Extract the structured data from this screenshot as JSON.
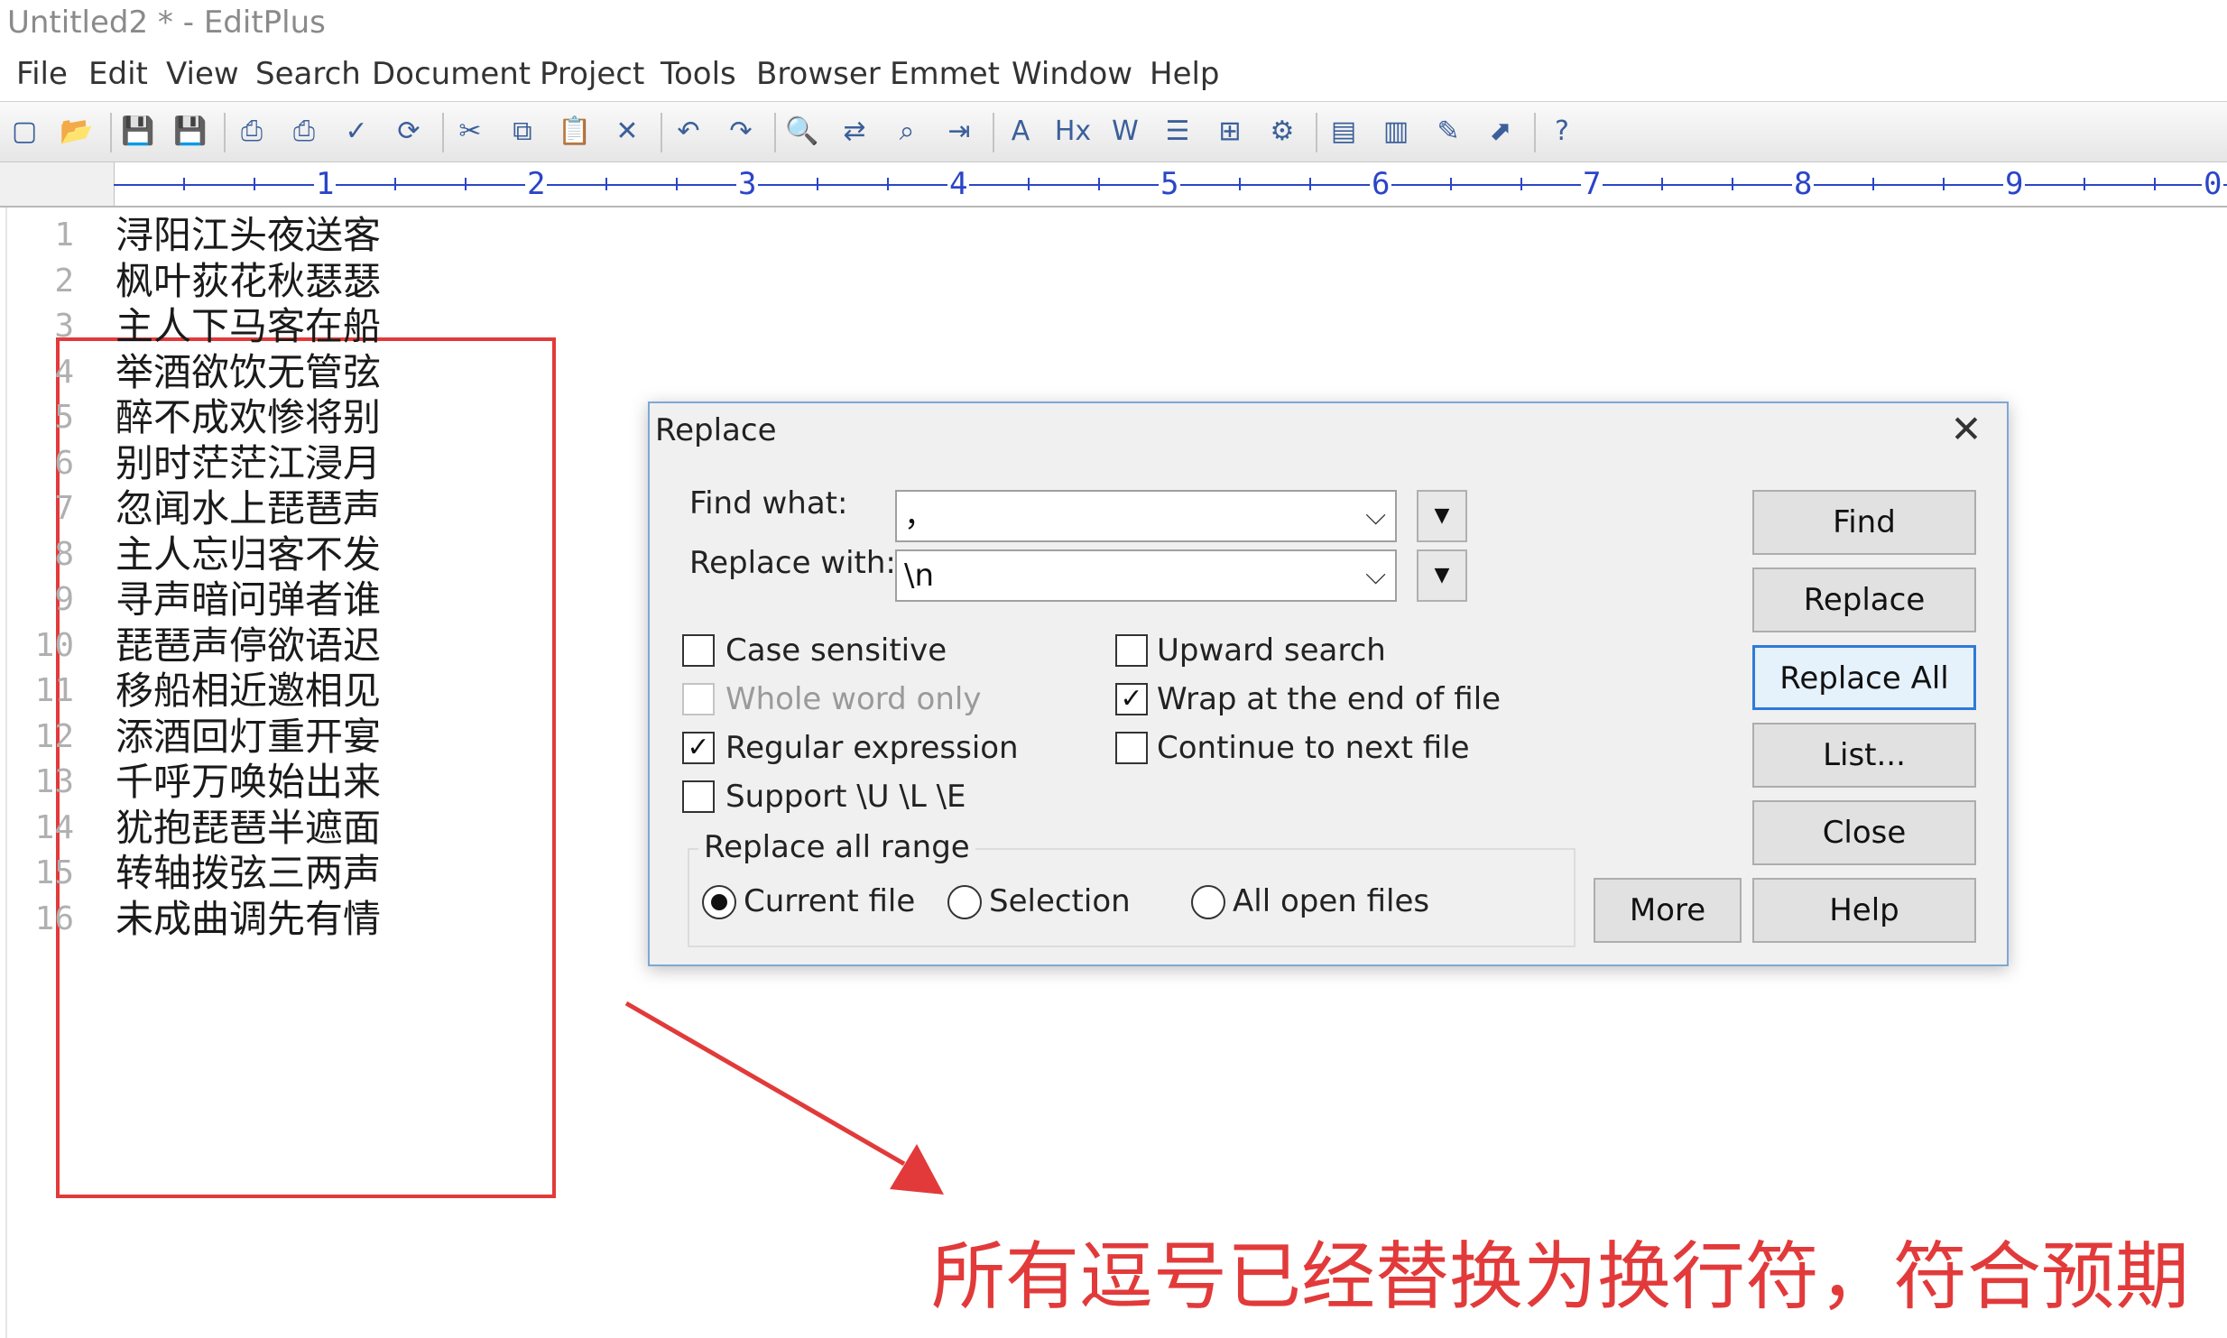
{
  "window": {
    "title": "Untitled2 * - EditPlus"
  },
  "menu": [
    "File",
    "Edit",
    "View",
    "Search",
    "Document",
    "Project",
    "Tools",
    "Browser",
    "Emmet",
    "Window",
    "Help"
  ],
  "toolbar": {
    "icons": [
      "new-file-icon",
      "open-file-icon",
      "save-icon",
      "save-all-icon",
      "print-preview-icon",
      "print-icon",
      "spell-check-icon",
      "refresh-icon",
      "cut-icon",
      "copy-icon",
      "paste-icon",
      "delete-icon",
      "undo-icon",
      "redo-icon",
      "find-icon",
      "replace-icon",
      "find-in-files-icon",
      "indent-icon",
      "font-icon",
      "hex-icon",
      "word-wrap-icon",
      "line-numbers-icon",
      "column-select-icon",
      "settings-icon",
      "browser-view-icon",
      "split-window-icon",
      "directory-window-icon",
      "output-window-icon",
      "help-icon"
    ],
    "glyphs": [
      "▢",
      "📂",
      "💾",
      "💾",
      "⎙",
      "⎙",
      "✓",
      "⟳",
      "✂",
      "⧉",
      "📋",
      "✕",
      "↶",
      "↷",
      "🔍",
      "⇄",
      "⌕",
      "⇥",
      "A",
      "Hx",
      "W",
      "☰",
      "⊞",
      "⚙",
      "▤",
      "▥",
      "✎",
      "⬈",
      "?"
    ]
  },
  "ruler": {
    "labels": [
      "1",
      "2",
      "3",
      "4",
      "5",
      "6",
      "7",
      "8",
      "9",
      "0"
    ]
  },
  "editor": {
    "lines": [
      {
        "n": "1",
        "text": "浔阳江头夜送客"
      },
      {
        "n": "2",
        "text": "枫叶荻花秋瑟瑟"
      },
      {
        "n": "3",
        "text": "主人下马客在船"
      },
      {
        "n": "4",
        "text": "举酒欲饮无管弦"
      },
      {
        "n": "5",
        "text": "醉不成欢惨将别"
      },
      {
        "n": "6",
        "text": "别时茫茫江浸月"
      },
      {
        "n": "7",
        "text": "忽闻水上琵琶声"
      },
      {
        "n": "8",
        "text": "主人忘归客不发"
      },
      {
        "n": "9",
        "text": "寻声暗问弹者谁"
      },
      {
        "n": "10",
        "text": "琵琶声停欲语迟"
      },
      {
        "n": "11",
        "text": "移船相近邀相见"
      },
      {
        "n": "12",
        "text": "添酒回灯重开宴"
      },
      {
        "n": "13",
        "text": "千呼万唤始出来"
      },
      {
        "n": "14",
        "text": "犹抱琵琶半遮面"
      },
      {
        "n": "15",
        "text": "转轴拨弦三两声"
      },
      {
        "n": "16",
        "text": "未成曲调先有情"
      }
    ]
  },
  "dialog": {
    "title": "Replace",
    "find_label": "Find what:",
    "find_value": "，",
    "replace_label": "Replace with:",
    "replace_value": "\\n",
    "options": {
      "case_sensitive": {
        "label": "Case sensitive",
        "checked": false
      },
      "whole_word": {
        "label": "Whole word only",
        "checked": false,
        "disabled": true
      },
      "regex": {
        "label": "Regular expression",
        "checked": true
      },
      "support_ulE": {
        "label": "Support \\U \\L \\E",
        "checked": false
      },
      "upward": {
        "label": "Upward search",
        "checked": false
      },
      "wrap": {
        "label": "Wrap at the end of file",
        "checked": true
      },
      "continue_next": {
        "label": "Continue to next file",
        "checked": false
      }
    },
    "range_title": "Replace all range",
    "range": [
      {
        "label": "Current file",
        "selected": true
      },
      {
        "label": "Selection",
        "selected": false
      },
      {
        "label": "All open files",
        "selected": false
      }
    ],
    "buttons": {
      "find": "Find",
      "replace": "Replace",
      "replace_all": "Replace All",
      "list": "List...",
      "close": "Close",
      "more": "More",
      "help": "Help"
    }
  },
  "annotation": {
    "caption": "所有逗号已经替换为换行符，符合预期",
    "color": "#e23a3a"
  }
}
